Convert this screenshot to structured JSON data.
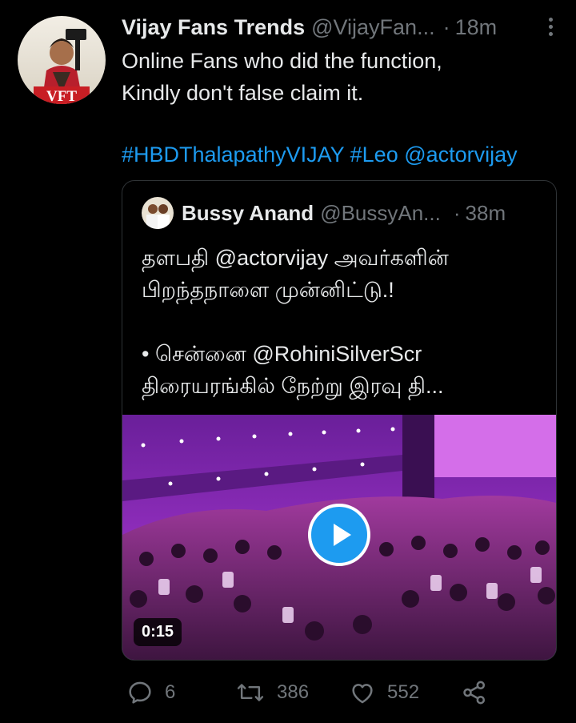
{
  "tweet": {
    "author_name": "Vijay Fans Trends",
    "author_handle": "@VijayFan...",
    "time_separator": "·",
    "time": "18m",
    "avatar_logo_text": "VFT",
    "text_lines": [
      "Online Fans who did the function,",
      "Kindly don't false claim it."
    ],
    "tags": "#HBDThalapathyVIJAY #Leo @actorvijay"
  },
  "quoted": {
    "author_name": "Bussy Anand",
    "author_handle": "@BussyAn...",
    "time_separator": "·",
    "time": "38m",
    "text_lines": [
      "தளபதி @actorvijay அவர்களின்",
      "பிறந்தநாளை முன்னிட்டு.!",
      "",
      "• சென்னை @RohiniSilverScr",
      "திரையரங்கில் நேற்று இரவு தி..."
    ],
    "video_duration": "0:15"
  },
  "actions": {
    "reply_count": "6",
    "retweet_count": "386",
    "like_count": "552"
  },
  "colors": {
    "background": "#000000",
    "accent": "#1d9bf0",
    "secondary_text": "#71767b",
    "video_tint": "#b23ad9"
  },
  "icons": [
    "more-icon",
    "play-icon",
    "reply-icon",
    "retweet-icon",
    "like-icon",
    "share-icon"
  ]
}
